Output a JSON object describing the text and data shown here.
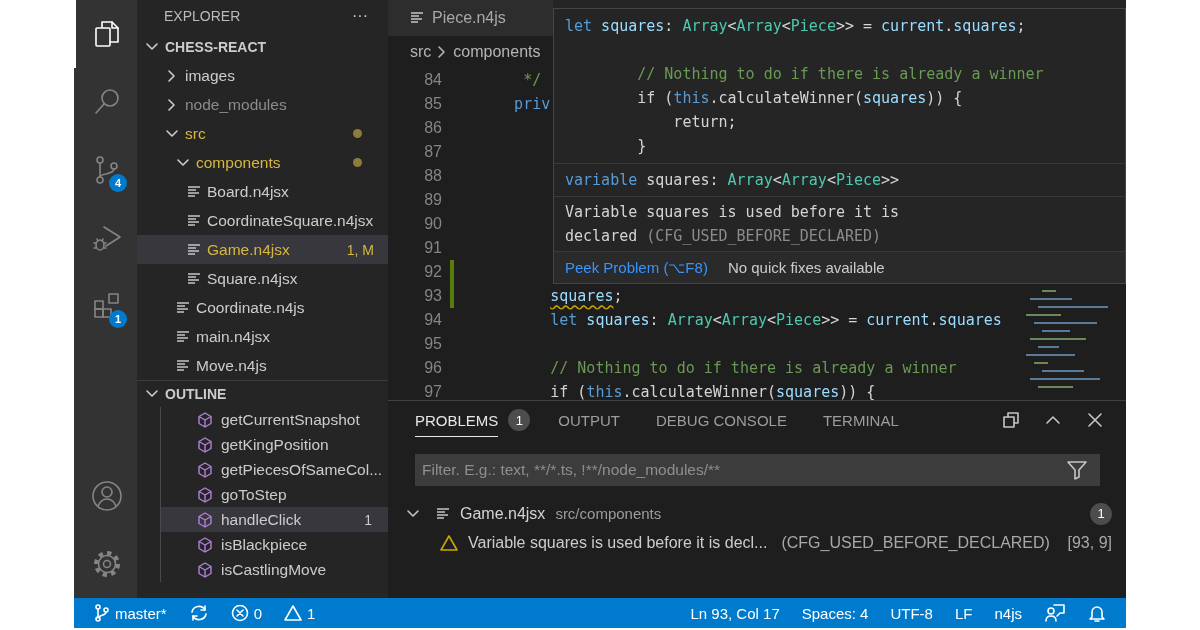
{
  "activity_bar": {
    "items": [
      {
        "kind": "explorer",
        "selected": true
      },
      {
        "kind": "search",
        "selected": false
      },
      {
        "kind": "source-control",
        "selected": false,
        "badge": "4"
      },
      {
        "kind": "run-debug",
        "selected": false
      },
      {
        "kind": "extensions",
        "selected": false,
        "badge": "1"
      }
    ],
    "bottom": [
      {
        "kind": "account"
      },
      {
        "kind": "settings"
      }
    ]
  },
  "sidebar": {
    "title": "EXPLORER",
    "more": "···",
    "folder": {
      "title": "CHESS-REACT",
      "expanded": true,
      "tree": [
        {
          "label": "images",
          "kind": "folder",
          "expanded": false,
          "modified": false,
          "ignored": false,
          "selected": false
        },
        {
          "label": "node_modules",
          "kind": "folder",
          "expanded": false,
          "modified": false,
          "ignored": true,
          "selected": false
        },
        {
          "label": "src",
          "kind": "folder",
          "expanded": true,
          "modified": true,
          "ignored": false,
          "selected": false,
          "children": [
            {
              "label": "components",
              "kind": "folder",
              "expanded": true,
              "modified": true,
              "ignored": false,
              "selected": false,
              "children": [
                {
                  "label": "Board.n4jsx",
                  "kind": "file",
                  "modified": false,
                  "ignored": false,
                  "selected": false
                },
                {
                  "label": "CoordinateSquare.n4jsx",
                  "kind": "file",
                  "modified": false,
                  "ignored": false,
                  "selected": false
                },
                {
                  "label": "Game.n4jsx",
                  "kind": "file",
                  "modified": true,
                  "ignored": false,
                  "selected": true,
                  "badge": "1, M"
                },
                {
                  "label": "Square.n4jsx",
                  "kind": "file",
                  "modified": false,
                  "ignored": false,
                  "selected": false
                }
              ]
            },
            {
              "label": "Coordinate.n4js",
              "kind": "file",
              "modified": false,
              "ignored": false,
              "selected": false
            },
            {
              "label": "main.n4jsx",
              "kind": "file",
              "modified": false,
              "ignored": false,
              "selected": false
            },
            {
              "label": "Move.n4js",
              "kind": "file",
              "modified": false,
              "ignored": false,
              "selected": false
            }
          ]
        }
      ]
    },
    "outline": {
      "title": "OUTLINE",
      "expanded": true,
      "items": [
        {
          "label": "getCurrentSnapshot",
          "selected": false
        },
        {
          "label": "getKingPosition",
          "selected": false
        },
        {
          "label": "getPiecesOfSameCol...",
          "selected": false
        },
        {
          "label": "goToStep",
          "selected": false
        },
        {
          "label": "handleClick",
          "selected": true,
          "badge": "1"
        },
        {
          "label": "isBlackpiece",
          "selected": false
        },
        {
          "label": "isCastlingMove",
          "selected": false
        }
      ]
    }
  },
  "editor": {
    "tabs": [
      {
        "label": "Piece.n4js",
        "selected": false
      }
    ],
    "breadcrumbs": [
      "src",
      "components"
    ],
    "lines": [
      {
        "number": "84",
        "modified": false,
        "tokens": [
          {
            "text": "     */",
            "kind": "comment"
          }
        ]
      },
      {
        "number": "85",
        "modified": false,
        "tokens": [
          {
            "text": "    priv",
            "kind": "keyword"
          }
        ]
      },
      {
        "number": "86",
        "modified": false
      },
      {
        "number": "87",
        "modified": false
      },
      {
        "number": "88",
        "modified": false
      },
      {
        "number": "89",
        "modified": false
      },
      {
        "number": "90",
        "modified": false
      },
      {
        "number": "91",
        "modified": false
      },
      {
        "number": "92",
        "modified": true
      },
      {
        "number": "93",
        "modified": true,
        "tokens": [
          {
            "text": "        squares",
            "kind": "variable",
            "warning": true
          },
          {
            "text": ";",
            "kind": "plain"
          }
        ]
      },
      {
        "number": "94",
        "modified": false,
        "tokens": [
          {
            "text": "        let",
            "kind": "keyword"
          },
          {
            "text": " squares",
            "kind": "variable"
          },
          {
            "text": ": ",
            "kind": "plain"
          },
          {
            "text": "Array",
            "kind": "type"
          },
          {
            "text": "<",
            "kind": "plain"
          },
          {
            "text": "Array",
            "kind": "type"
          },
          {
            "text": "<",
            "kind": "plain"
          },
          {
            "text": "Piece",
            "kind": "type"
          },
          {
            "text": ">> = ",
            "kind": "plain"
          },
          {
            "text": "current",
            "kind": "variable"
          },
          {
            "text": ".",
            "kind": "plain"
          },
          {
            "text": "squares",
            "kind": "variable"
          }
        ]
      },
      {
        "number": "95",
        "modified": false
      },
      {
        "number": "96",
        "modified": false,
        "tokens": [
          {
            "text": "        // Nothing to do if there is already a winner",
            "kind": "comment"
          }
        ]
      },
      {
        "number": "97",
        "modified": false,
        "tokens": [
          {
            "text": "        if (",
            "kind": "plain"
          },
          {
            "text": "this",
            "kind": "keyword"
          },
          {
            "text": ".calculateWinner(",
            "kind": "plain"
          },
          {
            "text": "squares",
            "kind": "variable"
          },
          {
            "text": ")) {",
            "kind": "plain"
          }
        ]
      }
    ],
    "hover": {
      "code": [
        {
          "kind": "code",
          "tokens": [
            {
              "text": "let",
              "kind": "keyword"
            },
            {
              "text": " squares",
              "kind": "variable"
            },
            {
              "text": ": ",
              "kind": "plain"
            },
            {
              "text": "Array",
              "kind": "type"
            },
            {
              "text": "<",
              "kind": "plain"
            },
            {
              "text": "Array",
              "kind": "type"
            },
            {
              "text": "<",
              "kind": "plain"
            },
            {
              "text": "Piece",
              "kind": "type"
            },
            {
              "text": ">> = ",
              "kind": "plain"
            },
            {
              "text": "current",
              "kind": "variable"
            },
            {
              "text": ".",
              "kind": "plain"
            },
            {
              "text": "squares",
              "kind": "variable"
            },
            {
              "text": ";",
              "kind": "plain"
            }
          ]
        },
        {
          "kind": "blank"
        },
        {
          "kind": "code",
          "tokens": [
            {
              "text": "        // Nothing to do if there is already a winner",
              "kind": "comment"
            }
          ]
        },
        {
          "kind": "code",
          "tokens": [
            {
              "text": "        if (",
              "kind": "plain"
            },
            {
              "text": "this",
              "kind": "keyword"
            },
            {
              "text": ".calculateWinner(",
              "kind": "plain"
            },
            {
              "text": "squares",
              "kind": "variable"
            },
            {
              "text": ")) {",
              "kind": "plain"
            }
          ]
        },
        {
          "kind": "code",
          "tokens": [
            {
              "text": "            return;",
              "kind": "plain"
            }
          ]
        },
        {
          "kind": "code",
          "tokens": [
            {
              "text": "        }",
              "kind": "plain"
            }
          ]
        }
      ],
      "signature": [
        {
          "text": "variable",
          "kind": "keyword"
        },
        {
          "text": " squares: ",
          "kind": "plain"
        },
        {
          "text": "Array",
          "kind": "type"
        },
        {
          "text": "<",
          "kind": "plain"
        },
        {
          "text": "Array",
          "kind": "type"
        },
        {
          "text": "<",
          "kind": "plain"
        },
        {
          "text": "Piece",
          "kind": "type"
        },
        {
          "text": ">>",
          "kind": "plain"
        }
      ],
      "message": "Variable squares is used before it is declared",
      "error_code": "(CFG_USED_BEFORE_DECLARED)",
      "actions": [
        {
          "label": "Peek Problem (⌥F8)",
          "kind": "link"
        },
        {
          "label": "No quick fixes available",
          "kind": "info"
        }
      ]
    }
  },
  "panel": {
    "tabs": [
      {
        "label": "PROBLEMS",
        "selected": true,
        "badge": "1"
      },
      {
        "label": "OUTPUT",
        "selected": false
      },
      {
        "label": "DEBUG CONSOLE",
        "selected": false
      },
      {
        "label": "TERMINAL",
        "selected": false
      }
    ],
    "actions": [
      {
        "kind": "restore"
      },
      {
        "kind": "collapse"
      },
      {
        "kind": "close"
      }
    ],
    "filter": {
      "placeholder": "Filter. E.g.: text, **/*.ts, !**/node_modules/**"
    },
    "problems": [
      {
        "file": "Game.n4jsx",
        "path": "src/components",
        "count": "1",
        "expanded": true,
        "items": [
          {
            "kind": "warning",
            "message": "Variable squares is used before it is decl...",
            "code": "(CFG_USED_BEFORE_DECLARED)",
            "position": "[93, 9]"
          }
        ]
      }
    ]
  },
  "status_bar": {
    "left": [
      {
        "kind": "branch",
        "label": "master*"
      },
      {
        "kind": "sync"
      },
      {
        "kind": "errors",
        "label": "0"
      },
      {
        "kind": "warnings",
        "label": "1"
      }
    ],
    "right": [
      {
        "kind": "text",
        "label": "Ln 93, Col 17"
      },
      {
        "kind": "text",
        "label": "Spaces: 4"
      },
      {
        "kind": "text",
        "label": "UTF-8"
      },
      {
        "kind": "text",
        "label": "LF"
      },
      {
        "kind": "text",
        "label": "n4js"
      },
      {
        "kind": "feedback"
      },
      {
        "kind": "bell"
      }
    ]
  }
}
